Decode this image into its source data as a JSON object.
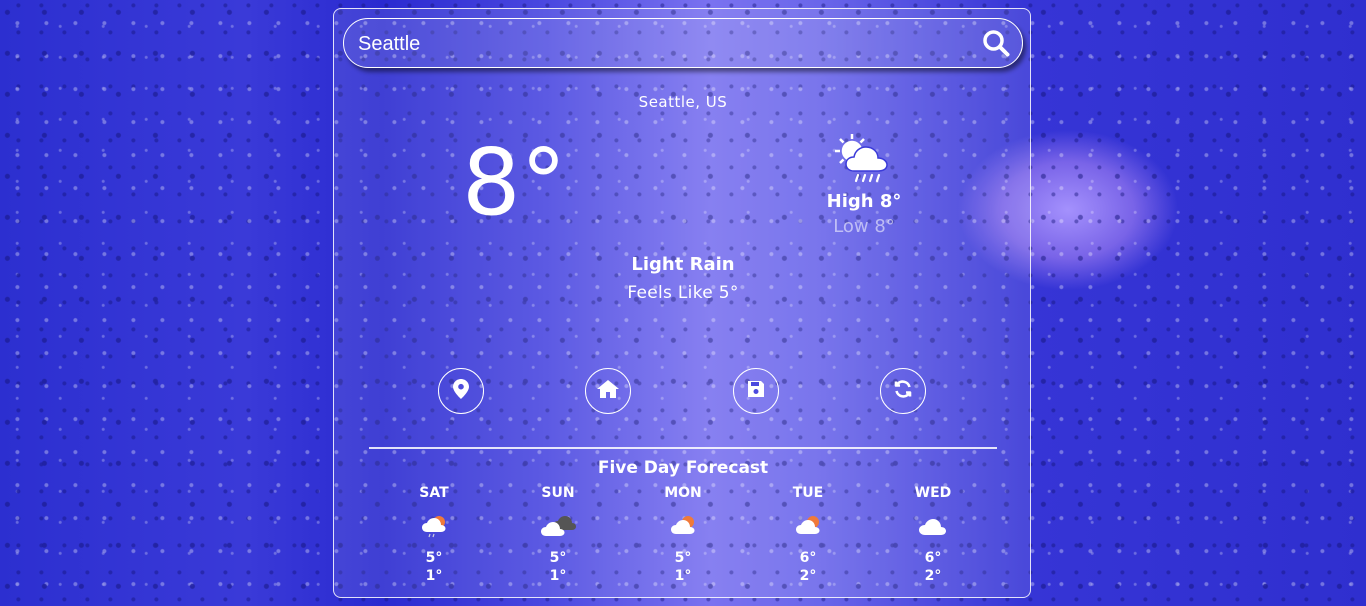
{
  "search": {
    "value": "Seattle"
  },
  "current": {
    "location": "Seattle, US",
    "temperature": "8°",
    "high": "High 8°",
    "low": "Low 8°",
    "description": "Light Rain",
    "feels_like": "Feels Like 5°",
    "icon": "sun-cloud-rain-icon"
  },
  "actions": [
    {
      "icon": "location-pin-icon"
    },
    {
      "icon": "home-icon"
    },
    {
      "icon": "save-icon"
    },
    {
      "icon": "refresh-icon"
    }
  ],
  "forecast": {
    "title": "Five Day Forecast",
    "days": [
      {
        "name": "SAT",
        "hi": "5°",
        "lo": "1°",
        "icon": "partly-cloudy-rain-icon"
      },
      {
        "name": "SUN",
        "hi": "5°",
        "lo": "1°",
        "icon": "cloudy-icon"
      },
      {
        "name": "MON",
        "hi": "5°",
        "lo": "1°",
        "icon": "partly-cloudy-icon"
      },
      {
        "name": "TUE",
        "hi": "6°",
        "lo": "2°",
        "icon": "partly-cloudy-icon"
      },
      {
        "name": "WED",
        "hi": "6°",
        "lo": "2°",
        "icon": "cloud-icon"
      }
    ]
  }
}
